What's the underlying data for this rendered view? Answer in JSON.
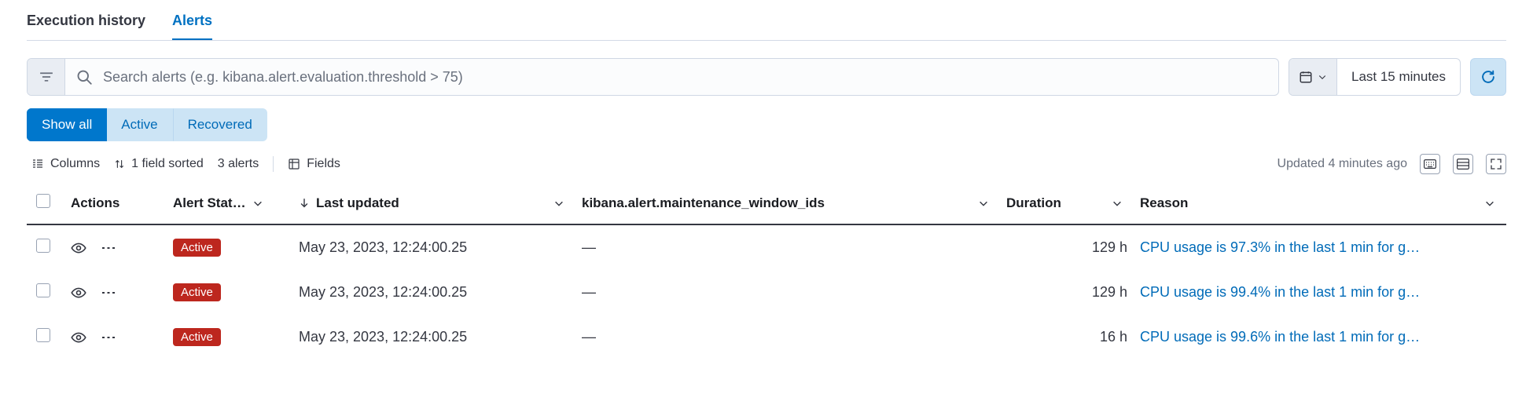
{
  "tabs": {
    "history": "Execution history",
    "alerts": "Alerts"
  },
  "search": {
    "placeholder": "Search alerts (e.g. kibana.alert.evaluation.threshold > 75)"
  },
  "time": {
    "label": "Last 15 minutes"
  },
  "status_filters": {
    "all": "Show all",
    "active": "Active",
    "recovered": "Recovered"
  },
  "databar": {
    "columns": "Columns",
    "sorted": "1 field sorted",
    "count": "3 alerts",
    "fields": "Fields",
    "updated": "Updated 4 minutes ago"
  },
  "headers": {
    "actions": "Actions",
    "status": "Alert Stat…",
    "updated": "Last updated",
    "mw": "kibana.alert.maintenance_window_ids",
    "duration": "Duration",
    "reason": "Reason"
  },
  "rows": [
    {
      "status": "Active",
      "updated": "May 23, 2023, 12:24:00.25",
      "mw": "—",
      "duration": "129 h",
      "reason": "CPU usage is 97.3% in the last 1 min for g…"
    },
    {
      "status": "Active",
      "updated": "May 23, 2023, 12:24:00.25",
      "mw": "—",
      "duration": "129 h",
      "reason": "CPU usage is 99.4% in the last 1 min for g…"
    },
    {
      "status": "Active",
      "updated": "May 23, 2023, 12:24:00.25",
      "mw": "—",
      "duration": "16 h",
      "reason": "CPU usage is 99.6% in the last 1 min for g…"
    }
  ]
}
